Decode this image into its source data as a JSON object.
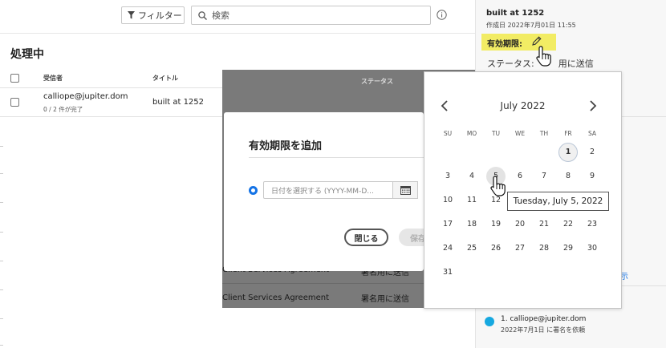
{
  "toolbar": {
    "filter_label": "フィルター",
    "search_placeholder": "検索"
  },
  "page_title": "処理中",
  "table": {
    "headers": {
      "recipient": "受信者",
      "title": "タイトル",
      "status": "ステータス"
    },
    "rows": [
      {
        "recipient": "calliope@jupiter.dom",
        "progress": "0 / 2 件が完了",
        "title": "built at 1252"
      }
    ],
    "covered_rows": [
      {
        "title": "Client Services Agreement",
        "status": "署名用に送信"
      },
      {
        "title": "Client Services Agreement",
        "status": "署名用に送信"
      }
    ]
  },
  "modal": {
    "title": "有効期限を追加",
    "date_placeholder": "日付を選択する (YYYY-MM-D...",
    "close_label": "閉じる",
    "save_label": "保存"
  },
  "calendar": {
    "month_label": "July 2022",
    "weekdays": [
      "SU",
      "MO",
      "TU",
      "WE",
      "TH",
      "FR",
      "SA"
    ],
    "weeks": [
      [
        "",
        "",
        "",
        "",
        "",
        "1",
        "2"
      ],
      [
        "3",
        "4",
        "5",
        "6",
        "7",
        "8",
        "9"
      ],
      [
        "10",
        "11",
        "12",
        "13",
        "14",
        "15",
        "16"
      ],
      [
        "17",
        "18",
        "19",
        "20",
        "21",
        "22",
        "23"
      ],
      [
        "24",
        "25",
        "26",
        "27",
        "28",
        "29",
        "30"
      ],
      [
        "31",
        "",
        "",
        "",
        "",
        "",
        ""
      ]
    ],
    "today": "1",
    "hovered": "5",
    "tooltip": "Tuesday, July 5, 2022"
  },
  "details": {
    "title": "built at 1252",
    "created": "作成日 2022年7月01日 11:55",
    "expiry_label": "有効期限:",
    "status_prefix": "ステータス:",
    "status_suffix": "用に送信",
    "link_fragment": "示",
    "signer": "1. calliope@jupiter.dom",
    "signer_sub": "2022年7月1日 に署名を依頼"
  },
  "colors": {
    "accent": "#1473e6",
    "highlight": "#f2ec64",
    "overlay": "#7a7a7a",
    "avatar": "#16a8e0"
  }
}
